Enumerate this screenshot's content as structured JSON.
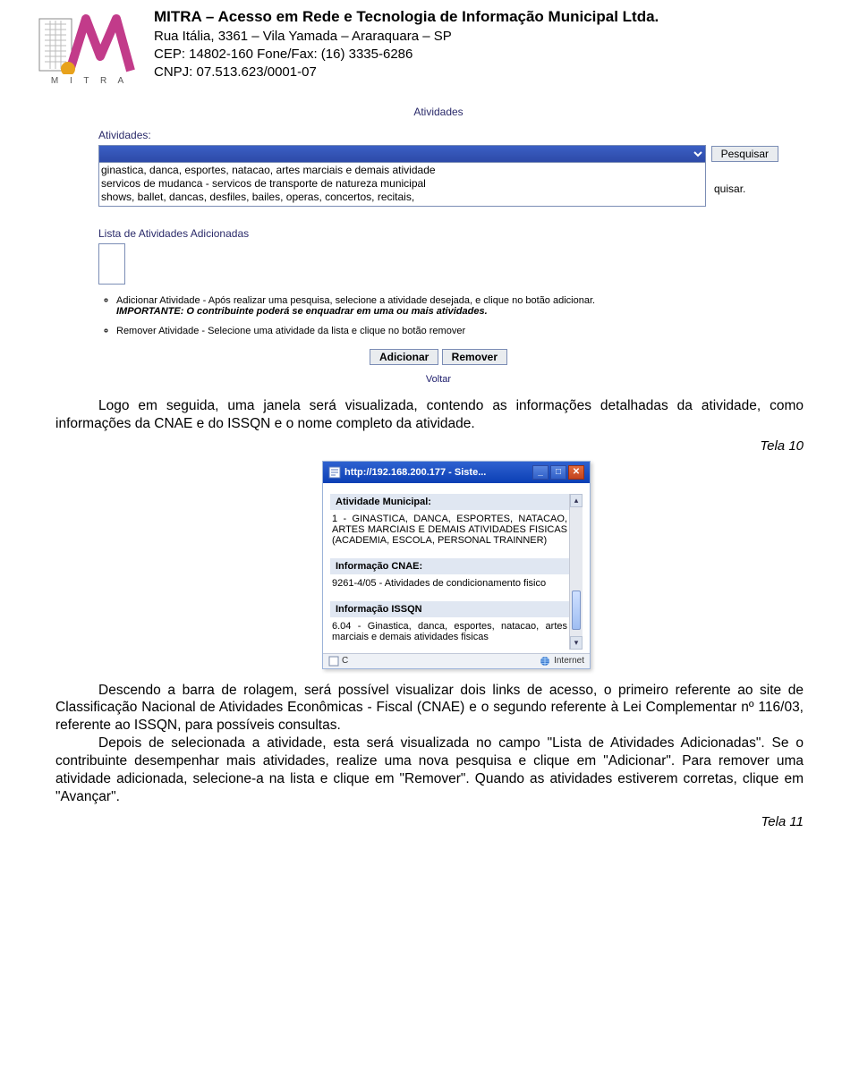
{
  "letterhead": {
    "company": "MITRA – Acesso em Rede e Tecnologia de Informação Municipal Ltda.",
    "address": "Rua Itália, 3361 – Vila Yamada – Araraquara – SP",
    "cep_phone": "CEP: 14802-160 Fone/Fax: (16) 3335-6286",
    "cnpj": "CNPJ: 07.513.623/0001-07",
    "logo_letters": "M I T R A"
  },
  "screenshot1": {
    "title": "Atividades",
    "label_atividades": "Atividades:",
    "search_button": "Pesquisar",
    "word_after": "quisar.",
    "list_items": [
      "ginastica, danca, esportes, natacao, artes marciais e demais atividade",
      "servicos de mudanca - servicos de transporte de natureza municipal",
      "shows, ballet, dancas, desfiles, bailes, operas, concertos, recitais,"
    ],
    "list_header": "Lista de Atividades Adicionadas",
    "bullet_add": "Adicionar Atividade - Após realizar uma pesquisa, selecione a atividade desejada, e clique no botão adicionar.",
    "bullet_add_important": "IMPORTANTE: O contribuinte poderá se enquadrar em uma ou mais atividades.",
    "bullet_remove": "Remover Atividade - Selecione uma atividade da lista e clique no botão remover",
    "btn_add": "Adicionar",
    "btn_remove": "Remover",
    "back": "Voltar"
  },
  "para1": "Logo em seguida, uma janela será visualizada, contendo as informações detalhadas da atividade, como informações da CNAE e do ISSQN e o nome completo da atividade.",
  "tela10": "Tela 10",
  "screenshot2": {
    "url_title": "http://192.168.200.177 - Siste...",
    "head_atividade": "Atividade Municipal:",
    "atividade_text": "1 - GINASTICA, DANCA, ESPORTES, NATACAO, ARTES MARCIAIS E DEMAIS ATIVIDADES FISICAS (ACADEMIA, ESCOLA, PERSONAL TRAINNER)",
    "head_cnae": "Informação CNAE:",
    "cnae_text": "9261-4/05 - Atividades de condicionamento fisico",
    "head_issqn": "Informação ISSQN",
    "issqn_text": "6.04 - Ginastica, danca, esportes, natacao, artes marciais e demais atividades fisicas",
    "status_left": "C",
    "status_right": "Internet"
  },
  "para2_a": "Descendo a barra de rolagem, será possível visualizar dois links de acesso, o primeiro referente ao site de Classificação Nacional de Atividades Econômicas - Fiscal (CNAE) e o segundo referente à Lei Complementar nº 116/03, referente ao ISSQN, para possíveis consultas.",
  "para2_b": "Depois de selecionada a atividade, esta será visualizada no campo \"Lista de Atividades Adicionadas\". Se o contribuinte desempenhar mais atividades, realize uma nova pesquisa e clique em \"Adicionar\". Para remover uma atividade adicionada, selecione-a na lista e clique em \"Remover\". Quando as atividades estiverem corretas, clique em \"Avançar\".",
  "tela11": "Tela 11"
}
